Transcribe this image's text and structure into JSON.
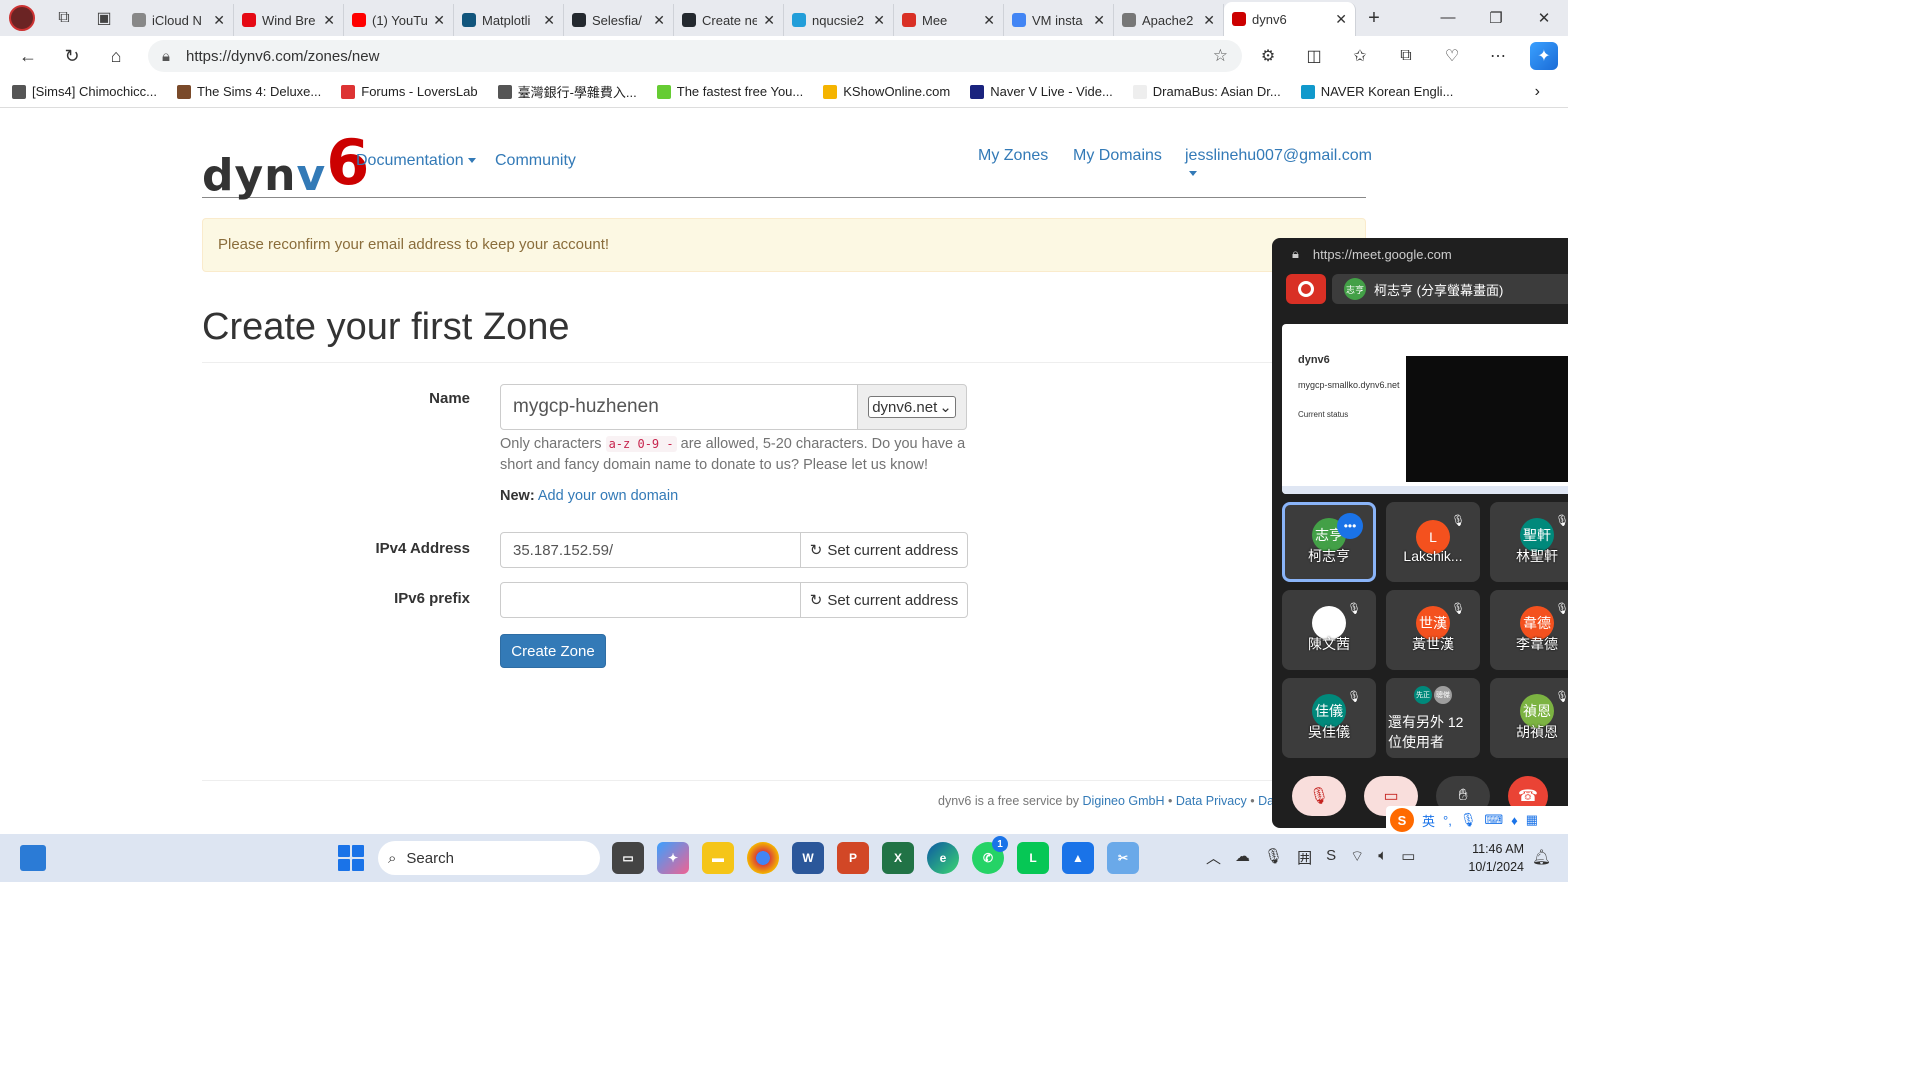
{
  "browser": {
    "tabs": [
      {
        "title": "iCloud N",
        "color": "#888"
      },
      {
        "title": "Wind Bre",
        "color": "#e50914"
      },
      {
        "title": "(1) YouTu",
        "color": "#ff0000"
      },
      {
        "title": "Matplotli",
        "color": "#11557c"
      },
      {
        "title": "Selesfia/",
        "color": "#24292f"
      },
      {
        "title": "Create ne",
        "color": "#24292f"
      },
      {
        "title": "nqucsie2",
        "color": "#229ed9"
      },
      {
        "title": "Mee",
        "color": "#d93025"
      },
      {
        "title": "VM insta",
        "color": "#4285f4"
      },
      {
        "title": "Apache2",
        "color": "#777"
      },
      {
        "title": "dynv6",
        "color": "#c00"
      }
    ],
    "url": "https://dynv6.com/zones/new",
    "bookmarks": [
      {
        "label": "[Sims4] Chimochicc...",
        "color": "#555"
      },
      {
        "label": "The Sims 4: Deluxe...",
        "color": "#7a4a2a"
      },
      {
        "label": "Forums - LoversLab",
        "color": "#d33"
      },
      {
        "label": "臺灣銀行-學雜費入...",
        "color": "#555"
      },
      {
        "label": "The fastest free You...",
        "color": "#6c3"
      },
      {
        "label": "KShowOnline.com",
        "color": "#f5b400"
      },
      {
        "label": "Naver V Live - Vide...",
        "color": "#1a237e"
      },
      {
        "label": "DramaBus: Asian Dr...",
        "color": "#eee"
      },
      {
        "label": "NAVER Korean Engli...",
        "color": "#19c"
      }
    ]
  },
  "site": {
    "brand_dy": "dyn",
    "brand_v": "v",
    "brand_six": "6",
    "nav": {
      "documentation": "Documentation",
      "community": "Community",
      "my_zones": "My Zones",
      "my_domains": "My Domains",
      "account": "jesslinehu007@gmail.com"
    },
    "alert": "Please reconfirm your email address to keep your account!",
    "heading": "Create your first Zone",
    "form": {
      "name_label": "Name",
      "name_value": "mygcp-huzhenen",
      "domain_select": "dynv6.net",
      "help_1": "Only characters",
      "help_code_1": "a-z 0-9 -",
      "help_2": "are allowed, 5-20 characters. Do you have a short and fancy domain name to donate to us? Please let us know!",
      "new_label": "New:",
      "new_link": "Add your own domain",
      "ipv4_label": "IPv4 Address",
      "ipv4_value": "35.187.152.59/",
      "ipv6_label": "IPv6 prefix",
      "ipv6_value": "",
      "set_current": "Set current address",
      "submit": "Create Zone"
    },
    "footer": {
      "text": "dynv6 is a free service by",
      "company": "Digineo GmbH",
      "sep": "•",
      "privacy": "Data Privacy",
      "more": "Data"
    }
  },
  "meet": {
    "url": "https://meet.google.com",
    "presenter": "柯志亨 (分享螢幕畫面)",
    "presenter_initials": "志亨",
    "share_brand": "dynv6",
    "share_domain": "mygcp-smallko.dynv6.net",
    "share_status": "Current status",
    "participants": [
      {
        "initials": "志亨",
        "name": "柯志亨",
        "color": "#43a047"
      },
      {
        "initials": "L",
        "name": "Lakshik...",
        "color": "#f4511e"
      },
      {
        "initials": "聖軒",
        "name": "林聖軒",
        "color": "#00897b"
      },
      {
        "initials": "",
        "name": "陳文茜",
        "color": "#fff"
      },
      {
        "initials": "世漢",
        "name": "黃世漢",
        "color": "#f4511e"
      },
      {
        "initials": "韋德",
        "name": "李韋德",
        "color": "#f4511e"
      },
      {
        "initials": "佳儀",
        "name": "吳佳儀",
        "color": "#00897b"
      },
      {
        "initials": "禎恩",
        "name": "胡禎恩",
        "color": "#7cb342"
      }
    ],
    "others_text": "還有另外 12 位使用者",
    "others_avatars": [
      "先正",
      "聰傑"
    ]
  },
  "taskbar": {
    "search_placeholder": "Search",
    "time": "11:46 AM",
    "date": "10/1/2024",
    "whatsapp_badge": "1",
    "ime_lang": "英"
  }
}
